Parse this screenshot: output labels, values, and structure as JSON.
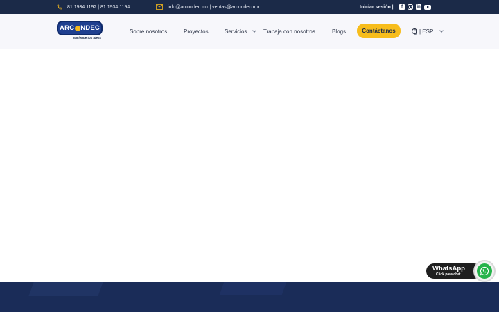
{
  "topbar": {
    "phone": "81 1934 1192 | 81 1934 1194",
    "email": "info@arcondec.mx | ventas@arcondec.mx",
    "login": "Iniciar sesión |",
    "socials": [
      "facebook-icon",
      "instagram-icon",
      "linkedin-icon",
      "youtube-icon"
    ]
  },
  "logo": {
    "name_left": "ARC",
    "name_right": "NDEC",
    "tagline": "Enciende tus ideas"
  },
  "nav": {
    "items": [
      "Sobre nosotros",
      "Proyectos",
      "Servicios",
      "Trabaja con nosotros",
      "Blogs"
    ],
    "cta": "Contáctanos",
    "lang": "| ESP"
  },
  "whatsapp": {
    "title": "WhatsApp",
    "subtitle": "Click para chat"
  },
  "colors": {
    "topbar": "#1b2a48",
    "accent": "#f7bd1c",
    "band": "#1a2c58",
    "whatsapp": "#25b34a"
  }
}
